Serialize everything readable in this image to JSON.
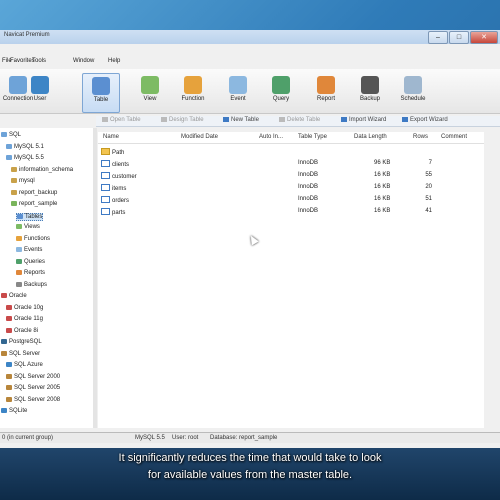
{
  "window": {
    "title": "Navicat Premium"
  },
  "menu": [
    "File",
    "Favorites",
    "Tools",
    "Window",
    "Help"
  ],
  "toolbar": [
    {
      "label": "Connection",
      "icon": "connection-icon",
      "color": "#6ea3d8"
    },
    {
      "label": "User",
      "icon": "user-icon",
      "color": "#3d85c6"
    },
    {
      "label": "Table",
      "icon": "table-icon",
      "color": "#5b8fd1",
      "selected": true
    },
    {
      "label": "View",
      "icon": "view-icon",
      "color": "#7dbb64"
    },
    {
      "label": "Function",
      "icon": "function-icon",
      "color": "#e6a23c"
    },
    {
      "label": "Event",
      "icon": "event-icon",
      "color": "#8cb8e0"
    },
    {
      "label": "Query",
      "icon": "query-icon",
      "color": "#4fa06a"
    },
    {
      "label": "Report",
      "icon": "report-icon",
      "color": "#e0873a"
    },
    {
      "label": "Backup",
      "icon": "backup-icon",
      "color": "#555555"
    },
    {
      "label": "Schedule",
      "icon": "schedule-icon",
      "color": "#9fb7cf"
    }
  ],
  "subtoolbar": [
    {
      "label": "Open Table",
      "enabled": false
    },
    {
      "label": "Design Table",
      "enabled": false
    },
    {
      "label": "New Table",
      "enabled": true
    },
    {
      "label": "Delete Table",
      "enabled": false
    },
    {
      "label": "Import Wizard",
      "enabled": true
    },
    {
      "label": "Export Wizard",
      "enabled": true
    }
  ],
  "tree": [
    {
      "label": "SQL",
      "level": 0,
      "color": "#6ea3d8"
    },
    {
      "label": "MySQL 5.1",
      "level": 1,
      "color": "#6ea3d8"
    },
    {
      "label": "MySQL 5.5",
      "level": 1,
      "color": "#6ea3d8"
    },
    {
      "label": "information_schema",
      "level": 2,
      "color": "#c9a24a"
    },
    {
      "label": "mysql",
      "level": 2,
      "color": "#c9a24a"
    },
    {
      "label": "report_backup",
      "level": 2,
      "color": "#c9a24a"
    },
    {
      "label": "report_sample",
      "level": 2,
      "color": "#7ab55c"
    },
    {
      "label": "Tables",
      "level": 3,
      "color": "#5b8fd1",
      "selected": true
    },
    {
      "label": "Views",
      "level": 3,
      "color": "#7dbb64"
    },
    {
      "label": "Functions",
      "level": 3,
      "color": "#e6a23c"
    },
    {
      "label": "Events",
      "level": 3,
      "color": "#8cb8e0"
    },
    {
      "label": "Queries",
      "level": 3,
      "color": "#4fa06a"
    },
    {
      "label": "Reports",
      "level": 3,
      "color": "#e0873a"
    },
    {
      "label": "Backups",
      "level": 3,
      "color": "#888888"
    },
    {
      "label": "Oracle",
      "level": 0,
      "color": "#c94a4a"
    },
    {
      "label": "Oracle 10g",
      "level": 1,
      "color": "#c94a4a"
    },
    {
      "label": "Oracle 11g",
      "level": 1,
      "color": "#c94a4a"
    },
    {
      "label": "Oracle 8i",
      "level": 1,
      "color": "#c94a4a"
    },
    {
      "label": "PostgreSQL",
      "level": 0,
      "color": "#336791"
    },
    {
      "label": "SQL Server",
      "level": 0,
      "color": "#b8863b"
    },
    {
      "label": "SQL Azure",
      "level": 1,
      "color": "#3d85c6"
    },
    {
      "label": "SQL Server 2000",
      "level": 1,
      "color": "#b8863b"
    },
    {
      "label": "SQL Server 2005",
      "level": 1,
      "color": "#b8863b"
    },
    {
      "label": "SQL Server 2008",
      "level": 1,
      "color": "#b8863b"
    },
    {
      "label": "SQLite",
      "level": 0,
      "color": "#3d85c6"
    }
  ],
  "columns": [
    "Name",
    "Modified Date",
    "Auto In...",
    "Table Type",
    "Data Length",
    "Rows",
    "Comment"
  ],
  "rows": [
    {
      "name": "Path",
      "kind": "folder",
      "engine": "",
      "length": "",
      "rows": ""
    },
    {
      "name": "clients",
      "kind": "table",
      "engine": "InnoDB",
      "length": "96 KB",
      "rows": "7"
    },
    {
      "name": "customer",
      "kind": "table",
      "engine": "InnoDB",
      "length": "16 KB",
      "rows": "55"
    },
    {
      "name": "items",
      "kind": "table",
      "engine": "InnoDB",
      "length": "16 KB",
      "rows": "20"
    },
    {
      "name": "orders",
      "kind": "table",
      "engine": "InnoDB",
      "length": "16 KB",
      "rows": "51"
    },
    {
      "name": "parts",
      "kind": "table",
      "engine": "InnoDB",
      "length": "16 KB",
      "rows": "41"
    }
  ],
  "status": {
    "left": "0 (in current group)",
    "connection": "MySQL 5.5",
    "user": "User: root",
    "database": "Database: report_sample"
  },
  "caption": {
    "line1": "It significantly reduces the time that would take to look",
    "line2": "for available values from the master table."
  }
}
